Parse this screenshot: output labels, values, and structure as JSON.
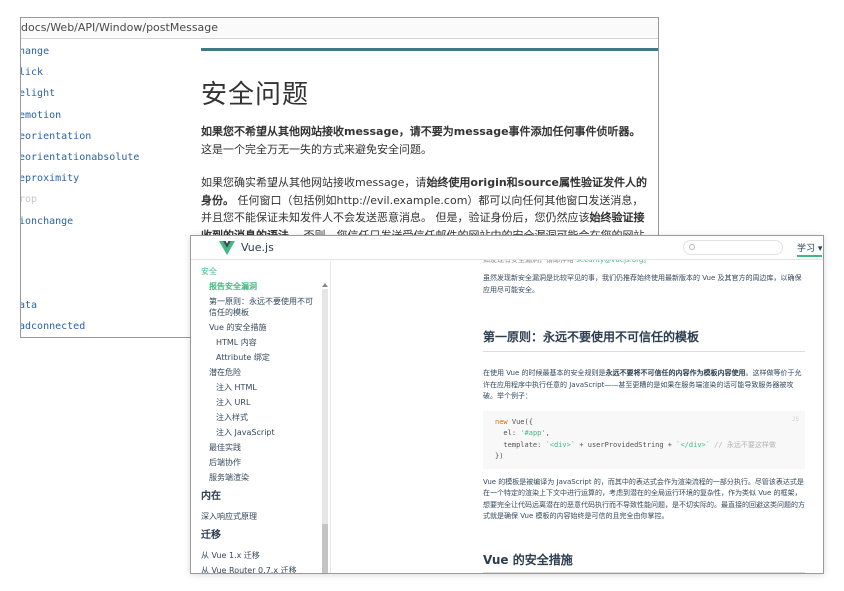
{
  "mdn": {
    "breadcrumb": "docs/Web/API/Window/postMessage",
    "sidebar_items": [
      "hange",
      "lick",
      "elight",
      "emotion",
      "eorientation",
      "eorientationabsolute",
      "eproximity",
      "rop",
      "ionchange",
      "",
      "",
      "",
      "ata",
      "adconnected"
    ],
    "heading": "安全问题",
    "para1_bold": "如果您不希望从其他网站接收message，请不要为message事件添加任何事件侦听器。",
    "para1_rest": " 这是一个完全万无一失的方式来避免安全问题。",
    "para2_start": "如果您确实希望从其他网站接收message，请",
    "para2_bold": "始终使用origin和source属性验证发件人的身份。",
    "para2_mid": " 任何窗口（包括例如http://evil.example.com）都可以向任何其他窗口发送消息，并且您不能保证未知发件人不会发送恶意消息。 但是，验证身份后，您仍然应该",
    "para2_bold2": "始终验证接收到的消息的语法",
    "para2_end": "。 否则，您信任只发送受信任邮件的网站中的安全漏洞可能会在您的网站中打开跨网站脚本"
  },
  "vue": {
    "brand": "Vue.js",
    "nav_learn": "学习 ▾",
    "sidebar": [
      {
        "text": "安全",
        "cls": "sec-green"
      },
      {
        "text": "报告安全漏洞",
        "cls": "l1 active"
      },
      {
        "text": "第一原则：永远不要使用不可信任的模板",
        "cls": "l1 wrap"
      },
      {
        "text": "Vue 的安全措施",
        "cls": "l1"
      },
      {
        "text": "HTML 内容",
        "cls": "l2"
      },
      {
        "text": "Attribute 绑定",
        "cls": "l2"
      },
      {
        "text": "潜在危险",
        "cls": "l1"
      },
      {
        "text": "注入 HTML",
        "cls": "l2"
      },
      {
        "text": "注入 URL",
        "cls": "l2"
      },
      {
        "text": "注入样式",
        "cls": "l2"
      },
      {
        "text": "注入 JavaScript",
        "cls": "l2"
      },
      {
        "text": "最佳实践",
        "cls": "l1"
      },
      {
        "text": "后端协作",
        "cls": "l1"
      },
      {
        "text": "服务端渲染",
        "cls": "l1"
      }
    ],
    "section_in": "内在",
    "item_reactivity": "深入响应式原理",
    "section_migration": "迁移",
    "item_migration_1": "从 Vue 1.x 迁移",
    "item_migration_2": "从 Vue Router 0.7.x 迁移",
    "top_line_a": "如发现有安全漏洞，请邮件给 ",
    "top_line_link": "security@vuejs.org",
    "top_line_b": "。",
    "para_rare": "虽然发现新安全漏洞是比较罕见的事，我们仍推荐始终使用最新版本的 Vue 及其官方的周边库，以确保应用尽可能安全。",
    "h2_first": "第一原则：永远不要使用不可信任的模板",
    "para_first_a": "在使用 Vue 的时候最基本的安全规则是",
    "para_first_bold": "永远不要将不可信任的内容作为模板内容使用",
    "para_first_b": "。这样做等价于允许在应用程序中执行任意的 JavaScript——甚至更糟的是如果在服务端渲染的话可能导致服务器被攻破。举个例子：",
    "code_lang": "JS",
    "code_line1_kw": "new",
    "code_line1_rest": " Vue({",
    "code_line2_a": "  el: ",
    "code_line2_str": "'#app'",
    "code_line2_b": ",",
    "code_line3_a": "  template: ",
    "code_line3_str1": "`<div>`",
    "code_line3_b": " + userProvidedString + ",
    "code_line3_str2": "`</div>`",
    "code_line3_cm": " // 永远不要这样做",
    "code_line4": "})",
    "para_template": "Vue 的模板是被编译为 JavaScript 的，而其中的表达式会作为渲染流程的一部分执行。尽管该表达式是在一个特定的渲染上下文中进行运算的，考虑到潜在的全局运行环境的复杂性，作为类似 Vue 的框架，想要完全让代码远离潜在的恶意代码执行而不导致性能问题，是不切实际的。最直接的回避这类问题的方式就是确保 Vue 模板的内容始终是可信的且完全由你掌控。",
    "h2_measures": "Vue 的安全措施"
  },
  "colors": {
    "vue_green": "#42b983",
    "mdn_link": "#2a62a6",
    "mdn_rule": "#3f7a82"
  }
}
